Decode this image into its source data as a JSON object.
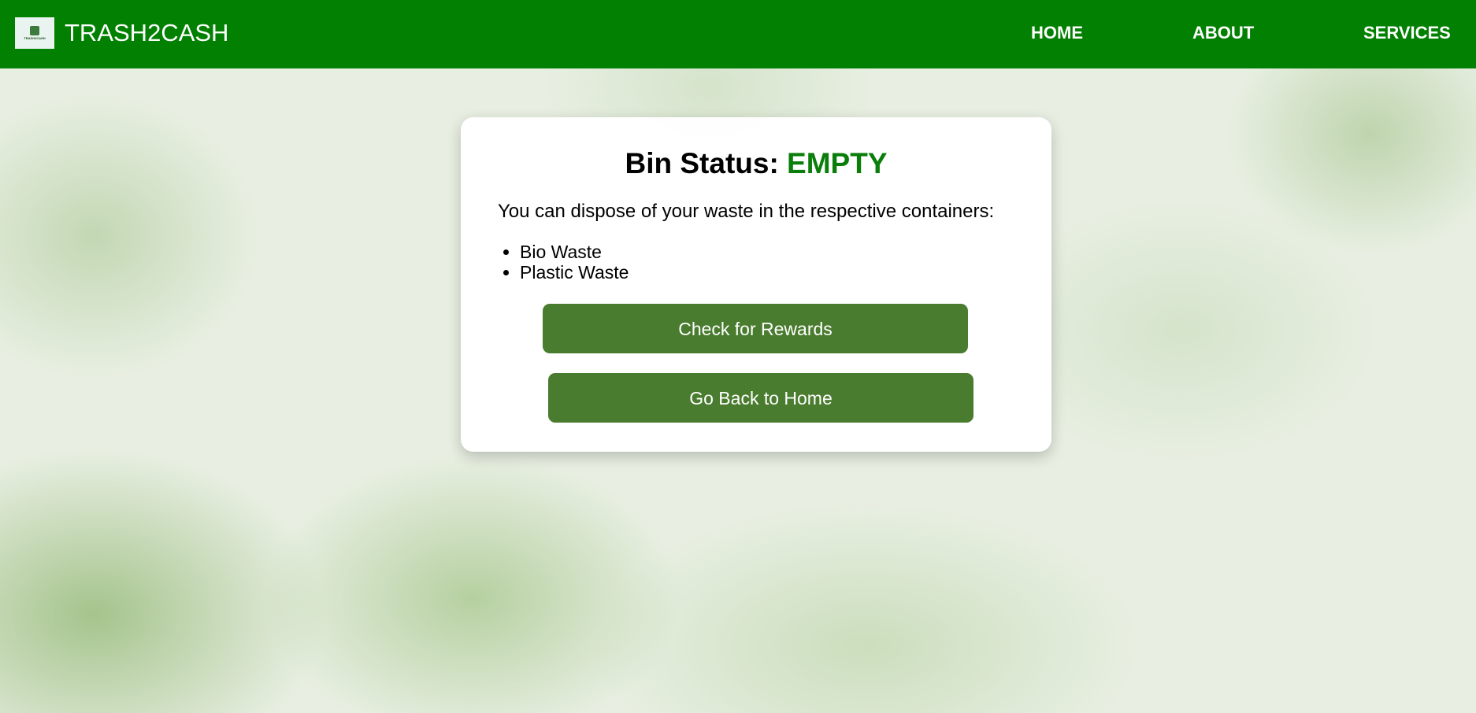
{
  "header": {
    "brand": "TRASH2CASH",
    "logo_text": "TRASH2CASH",
    "nav": [
      {
        "label": "HOME"
      },
      {
        "label": "ABOUT"
      },
      {
        "label": "SERVICES"
      }
    ],
    "background_color": "#018001"
  },
  "card": {
    "title_prefix": "Bin Status: ",
    "status": "EMPTY",
    "status_color": "#0a7d0a",
    "description": "You can dispose of your waste in the respective containers:",
    "waste_types": [
      "Bio Waste",
      "Plastic Waste"
    ],
    "buttons": {
      "rewards": "Check for Rewards",
      "home": "Go Back to Home"
    },
    "button_color": "#4a7c2f"
  }
}
